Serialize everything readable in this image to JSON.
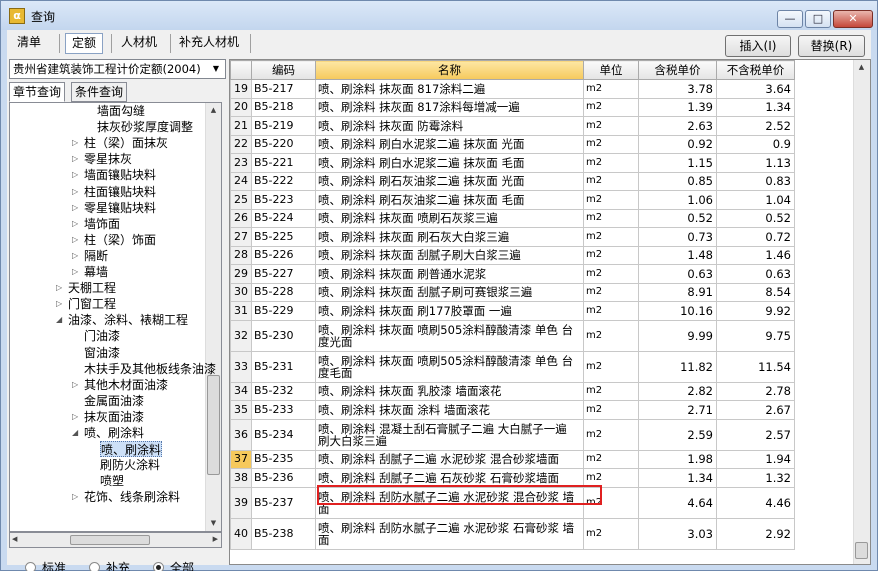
{
  "window": {
    "title": "查询",
    "minimize": "—",
    "maximize": "□",
    "close": "✕",
    "icon": "app-icon"
  },
  "tabs": [
    "清单",
    "定额",
    "人材机",
    "补充人材机"
  ],
  "buttons": {
    "insert": "插入(I)",
    "replace": "替换(R)"
  },
  "left": {
    "dropdown": "贵州省建筑装饰工程计价定额(2004)",
    "tabs": [
      "章节查询",
      "条件查询"
    ],
    "tree": [
      {
        "label": "墙面勾缝",
        "exp": ""
      },
      {
        "label": "抹灰砂浆厚度调整",
        "exp": ""
      },
      {
        "label": "柱（梁）面抹灰",
        "exp": "▷"
      },
      {
        "label": "零星抹灰",
        "exp": "▷"
      },
      {
        "label": "墙面镶贴块料",
        "exp": "▷"
      },
      {
        "label": "柱面镶贴块料",
        "exp": "▷"
      },
      {
        "label": "零星镶贴块料",
        "exp": "▷"
      },
      {
        "label": "墙饰面",
        "exp": "▷"
      },
      {
        "label": "柱（梁）饰面",
        "exp": "▷"
      },
      {
        "label": "隔断",
        "exp": "▷"
      },
      {
        "label": "幕墙",
        "exp": "▷"
      },
      {
        "label": "天棚工程",
        "exp": "▷"
      },
      {
        "label": "门窗工程",
        "exp": "▷"
      },
      {
        "label": "油漆、涂料、裱糊工程",
        "exp": "◢"
      },
      {
        "label": "门油漆",
        "exp": ""
      },
      {
        "label": "窗油漆",
        "exp": ""
      },
      {
        "label": "木扶手及其他板线条油漆",
        "exp": ""
      },
      {
        "label": "其他木材面油漆",
        "exp": "▷"
      },
      {
        "label": "金属面油漆",
        "exp": ""
      },
      {
        "label": "抹灰面油漆",
        "exp": "▷"
      },
      {
        "label": "喷、刷涂料",
        "exp": "◢"
      },
      {
        "label": "喷、刷涂料",
        "exp": ""
      },
      {
        "label": "刷防火涂料",
        "exp": ""
      },
      {
        "label": "喷塑",
        "exp": ""
      },
      {
        "label": "花饰、线条刷涂料",
        "exp": "▷"
      }
    ],
    "radios": [
      "标准",
      "补充",
      "全部"
    ],
    "radio_selected": 2
  },
  "grid": {
    "columns": [
      "",
      "编码",
      "名称",
      "单位",
      "含税单价",
      "不含税单价"
    ],
    "rows": [
      [
        "19",
        "B5-217",
        "喷、刷涂料 抹灰面 817涂料二遍",
        "m2",
        "3.78",
        "3.64"
      ],
      [
        "20",
        "B5-218",
        "喷、刷涂料 抹灰面 817涂料每增减一遍",
        "m2",
        "1.39",
        "1.34"
      ],
      [
        "21",
        "B5-219",
        "喷、刷涂料 抹灰面 防霉涂料",
        "m2",
        "2.63",
        "2.52"
      ],
      [
        "22",
        "B5-220",
        "喷、刷涂料 刷白水泥浆二遍 抹灰面 光面",
        "m2",
        "0.92",
        "0.9"
      ],
      [
        "23",
        "B5-221",
        "喷、刷涂料 刷白水泥浆二遍 抹灰面 毛面",
        "m2",
        "1.15",
        "1.13"
      ],
      [
        "24",
        "B5-222",
        "喷、刷涂料 刷石灰油浆二遍 抹灰面 光面",
        "m2",
        "0.85",
        "0.83"
      ],
      [
        "25",
        "B5-223",
        "喷、刷涂料 刷石灰油浆二遍 抹灰面 毛面",
        "m2",
        "1.06",
        "1.04"
      ],
      [
        "26",
        "B5-224",
        "喷、刷涂料 抹灰面 喷刷石灰浆三遍",
        "m2",
        "0.52",
        "0.52"
      ],
      [
        "27",
        "B5-225",
        "喷、刷涂料 抹灰面 刷石灰大白浆三遍",
        "m2",
        "0.73",
        "0.72"
      ],
      [
        "28",
        "B5-226",
        "喷、刷涂料 抹灰面 刮腻子刷大白浆三遍",
        "m2",
        "1.48",
        "1.46"
      ],
      [
        "29",
        "B5-227",
        "喷、刷涂料 抹灰面 刷普通水泥浆",
        "m2",
        "0.63",
        "0.63"
      ],
      [
        "30",
        "B5-228",
        "喷、刷涂料 抹灰面 刮腻子刷可赛银浆三遍",
        "m2",
        "8.91",
        "8.54"
      ],
      [
        "31",
        "B5-229",
        "喷、刷涂料 抹灰面 刷177胶罩面 一遍",
        "m2",
        "10.16",
        "9.92"
      ],
      [
        "32",
        "B5-230",
        "喷、刷涂料 抹灰面 喷刷505涂料醇酸清漆 单色 台度光面",
        "m2",
        "9.99",
        "9.75"
      ],
      [
        "33",
        "B5-231",
        "喷、刷涂料 抹灰面 喷刷505涂料醇酸清漆 单色 台度毛面",
        "m2",
        "11.82",
        "11.54"
      ],
      [
        "34",
        "B5-232",
        "喷、刷涂料 抹灰面 乳胶漆 墙面滚花",
        "m2",
        "2.82",
        "2.78"
      ],
      [
        "35",
        "B5-233",
        "喷、刷涂料 抹灰面 涂料 墙面滚花",
        "m2",
        "2.71",
        "2.67"
      ],
      [
        "36",
        "B5-234",
        "喷、刷涂料 混凝土刮石膏腻子二遍 大白腻子一遍 刷大白浆三遍",
        "m2",
        "2.59",
        "2.57"
      ],
      [
        "37",
        "B5-235",
        "喷、刷涂料 刮腻子二遍 水泥砂浆 混合砂浆墙面",
        "m2",
        "1.98",
        "1.94"
      ],
      [
        "38",
        "B5-236",
        "喷、刷涂料 刮腻子二遍 石灰砂浆 石膏砂浆墙面",
        "m2",
        "1.34",
        "1.32"
      ],
      [
        "39",
        "B5-237",
        "喷、刷涂料 刮防水腻子二遍 水泥砂浆 混合砂浆 墙面",
        "m2",
        "4.64",
        "4.46"
      ],
      [
        "40",
        "B5-238",
        "喷、刷涂料 刮防水腻子二遍 水泥砂浆 石膏砂浆 墙面",
        "m2",
        "3.03",
        "2.92"
      ]
    ],
    "tall_rows": [
      13,
      14,
      17,
      20,
      21
    ],
    "selected_row": 18
  }
}
